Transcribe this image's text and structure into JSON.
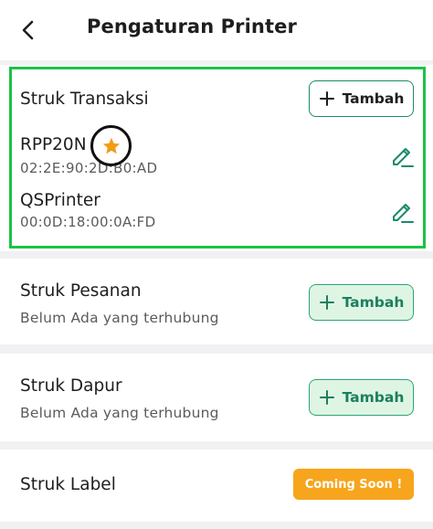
{
  "header": {
    "title": "Pengaturan Printer"
  },
  "sections": {
    "transaksi": {
      "title": "Struk Transaksi",
      "add_label": "Tambah",
      "printers": [
        {
          "name": "RPP20N",
          "mac": "02:2E:90:2D:B0:AD",
          "favorite": true
        },
        {
          "name": "QSPrinter",
          "mac": "00:0D:18:00:0A:FD",
          "favorite": false
        }
      ]
    },
    "pesanan": {
      "title": "Struk Pesanan",
      "status": "Belum Ada yang terhubung",
      "add_label": "Tambah"
    },
    "dapur": {
      "title": "Struk Dapur",
      "status": "Belum Ada yang terhubung",
      "add_label": "Tambah"
    },
    "label": {
      "title": "Struk Label",
      "badge": "Coming Soon !"
    }
  },
  "colors": {
    "accent_green": "#1a8a6a",
    "highlight_green": "#1dc247",
    "badge_orange": "#f7a51c",
    "star_orange": "#f29b16"
  }
}
